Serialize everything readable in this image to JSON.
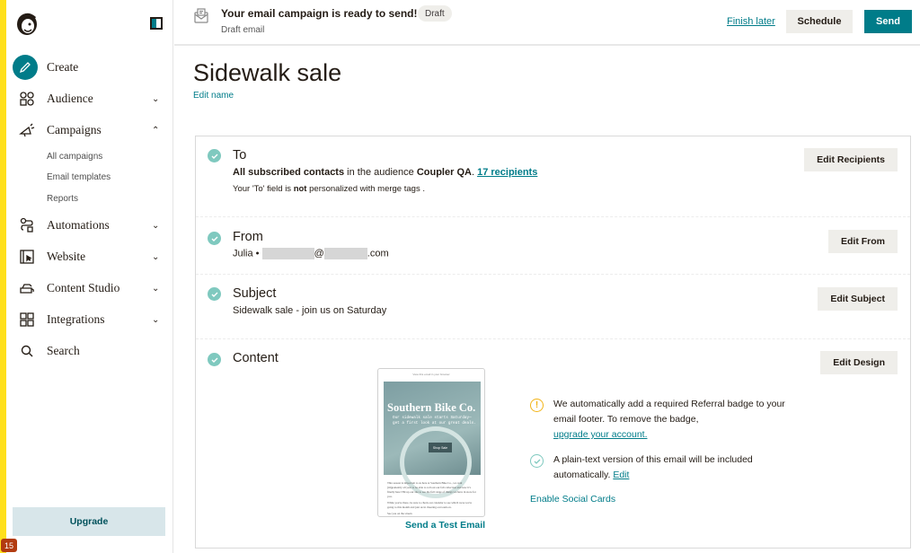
{
  "sidebar": {
    "items": [
      {
        "label": "Create",
        "icon": "pencil-icon"
      },
      {
        "label": "Audience",
        "icon": "audience-icon",
        "chevron": "⌄"
      },
      {
        "label": "Campaigns",
        "icon": "megaphone-icon",
        "chevron": "⌃"
      },
      {
        "label": "Automations",
        "icon": "automation-icon",
        "chevron": "⌄"
      },
      {
        "label": "Website",
        "icon": "website-icon",
        "chevron": "⌄"
      },
      {
        "label": "Content Studio",
        "icon": "content-studio-icon",
        "chevron": "⌄"
      },
      {
        "label": "Integrations",
        "icon": "grid-icon",
        "chevron": "⌄"
      },
      {
        "label": "Search",
        "icon": "search-icon"
      }
    ],
    "campaigns_sub": [
      "All campaigns",
      "Email templates",
      "Reports"
    ],
    "upgrade_label": "Upgrade",
    "notification_count": "15"
  },
  "header": {
    "title": "Your email campaign is ready to send!",
    "status_pill": "Draft",
    "subtitle": "Draft email",
    "finish_later": "Finish later",
    "schedule": "Schedule",
    "send": "Send"
  },
  "page": {
    "title": "Sidewalk sale",
    "edit_name": "Edit name"
  },
  "sections": {
    "to": {
      "title": "To",
      "audience_bold": "All subscribed contacts",
      "audience_mid": " in the audience ",
      "audience_name": "Coupler QA",
      "audience_dot": ". ",
      "recipients_link": "17 recipients",
      "note_pre": "Your 'To' field is ",
      "note_bold": "not",
      "note_post": " personalized with merge tags .",
      "button": "Edit Recipients"
    },
    "from": {
      "title": "From",
      "name": "Julia •",
      "at": "@",
      "domain_suffix": ".com",
      "button": "Edit From"
    },
    "subject": {
      "title": "Subject",
      "value": "Sidewalk sale - join us on Saturday",
      "button": "Edit Subject"
    },
    "content": {
      "title": "Content",
      "button": "Edit Design",
      "preview": {
        "top_link": "View this email in your browser",
        "brand": "Southern Bike Co.",
        "tagline_1": "Our sidewalk sale starts Saturday—",
        "tagline_2": "get a first look at our great deals.",
        "shop_button": "Shop Sale",
        "body_1": "This season is important to us here at Southern Bike Co., we wait (im)patiently all year to be able to roll out our fall collection and now it's finally here! Hit up our site to see the full range of things we have in store for you.",
        "body_2": "While you're there, be sure to check our calendar to see which races we're going to this month and join us in cheering our team on.",
        "body_3": "See you on the streets"
      },
      "test_email": "Send a Test Email",
      "referral_notice": "We automatically add a required Referral badge to your email footer. To remove the badge,",
      "referral_link": "upgrade your account.",
      "plaintext_notice": "A plain-text version of this email will be included automatically.",
      "plaintext_link": "Edit",
      "social_cards": "Enable Social Cards"
    }
  },
  "colors": {
    "brand_teal": "#007c89",
    "check_green": "#7fc9bf",
    "warning_yellow": "#f2b418",
    "sidebar_accent": "#ffe01b"
  }
}
